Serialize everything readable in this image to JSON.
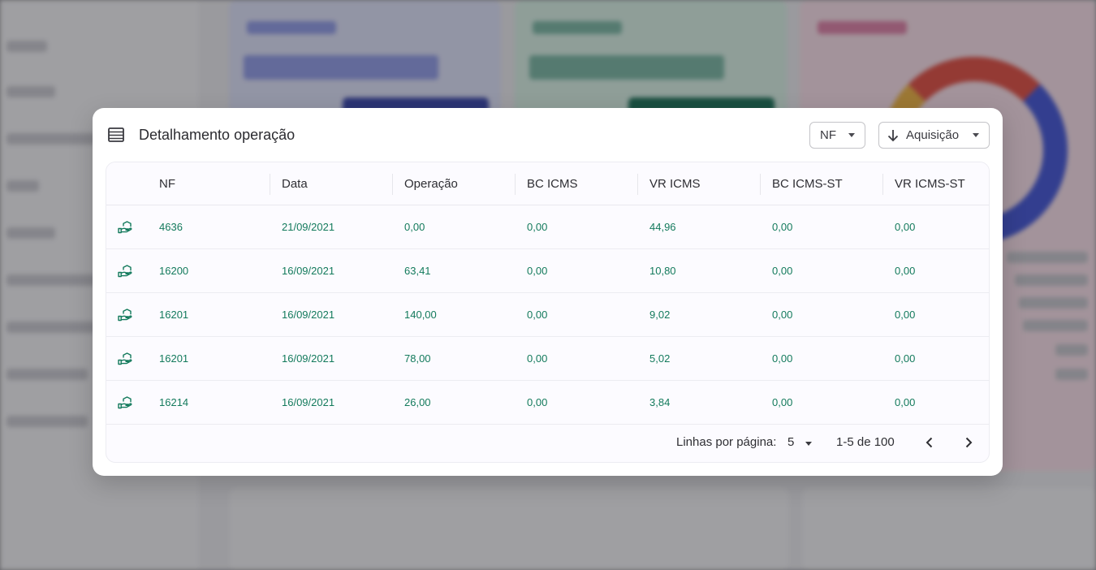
{
  "modal": {
    "title": "Detalhamento operação",
    "icon": "list-icon",
    "filters": {
      "type_select": {
        "value": "NF"
      },
      "sort_select": {
        "value": "Aquisição",
        "icon": "arrow-down-icon"
      }
    },
    "table": {
      "columns": [
        "NF",
        "Data",
        "Operação",
        "BC ICMS",
        "VR ICMS",
        "BC ICMS-ST",
        "VR ICMS-ST"
      ],
      "row_icon": "hand-money-icon",
      "rows": [
        {
          "nf": "4636",
          "data": "21/09/2021",
          "operacao": "0,00",
          "bc_icms": "0,00",
          "vr_icms": "44,96",
          "bc_icms_st": "0,00",
          "vr_icms_st": "0,00"
        },
        {
          "nf": "16200",
          "data": "16/09/2021",
          "operacao": "63,41",
          "bc_icms": "0,00",
          "vr_icms": "10,80",
          "bc_icms_st": "0,00",
          "vr_icms_st": "0,00"
        },
        {
          "nf": "16201",
          "data": "16/09/2021",
          "operacao": "140,00",
          "bc_icms": "0,00",
          "vr_icms": "9,02",
          "bc_icms_st": "0,00",
          "vr_icms_st": "0,00"
        },
        {
          "nf": "16201",
          "data": "16/09/2021",
          "operacao": "78,00",
          "bc_icms": "0,00",
          "vr_icms": "5,02",
          "bc_icms_st": "0,00",
          "vr_icms_st": "0,00"
        },
        {
          "nf": "16214",
          "data": "16/09/2021",
          "operacao": "26,00",
          "bc_icms": "0,00",
          "vr_icms": "3,84",
          "bc_icms_st": "0,00",
          "vr_icms_st": "0,00"
        }
      ]
    },
    "pagination": {
      "rows_per_page_label": "Linhas por página:",
      "rows_per_page": "5",
      "range": "1-5 de 100"
    }
  },
  "colors": {
    "value_green": "#137a5c",
    "card_blue": "#dfe3fb",
    "card_green": "#d9f3e6",
    "card_pink": "#fbe1ea"
  }
}
